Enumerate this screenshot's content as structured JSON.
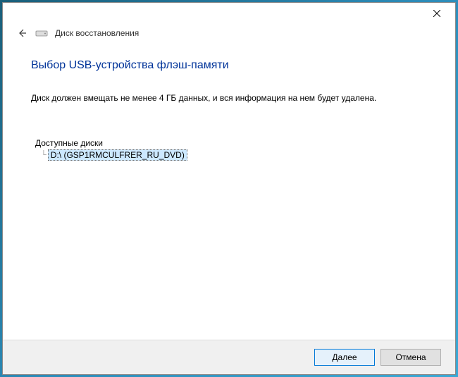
{
  "window": {
    "title": "Диск восстановления"
  },
  "main": {
    "heading": "Выбор USB-устройства флэш-памяти",
    "description": "Диск должен вмещать не менее 4 ГБ данных, и вся информация на нем будет удалена.",
    "drives_label": "Доступные диски",
    "drives": [
      {
        "label": "D:\\ (GSP1RMCULFRER_RU_DVD)"
      }
    ]
  },
  "footer": {
    "next_label": "Далее",
    "cancel_label": "Отмена"
  }
}
